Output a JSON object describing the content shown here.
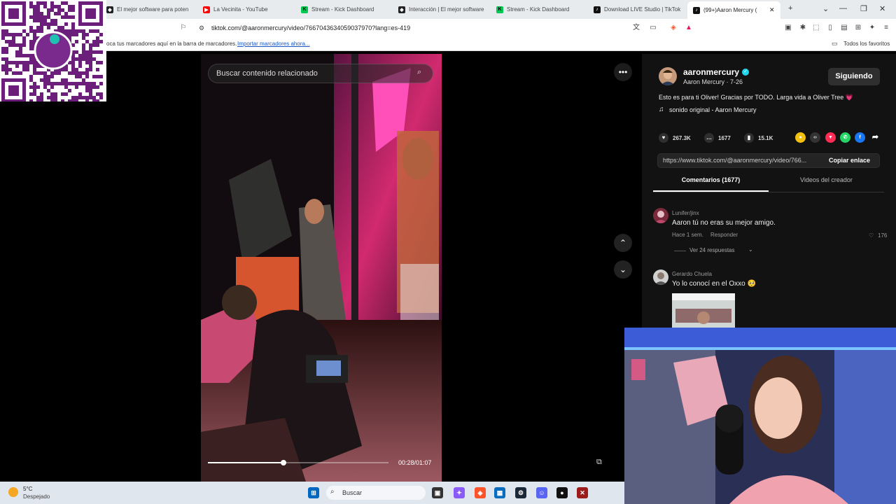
{
  "browser": {
    "tabs": [
      {
        "label": "El mejor software para poten",
        "favicon": "tiktok-studio-icon",
        "color": "#222"
      },
      {
        "label": "La Vecinita - YouTube",
        "favicon": "youtube-icon",
        "color": "#ff0000"
      },
      {
        "label": "Stream - Kick Dashboard",
        "favicon": "kick-icon",
        "color": "#00c853"
      },
      {
        "label": "Interacción | El mejor software",
        "favicon": "tiktok-studio-icon",
        "color": "#222"
      },
      {
        "label": "Stream - Kick Dashboard",
        "favicon": "kick-icon",
        "color": "#00c853"
      },
      {
        "label": "Download LIVE Studio | TikTok",
        "favicon": "tiktok-icon",
        "color": "#111"
      },
      {
        "label": "(99+)Aaron Mercury (",
        "favicon": "tiktok-icon",
        "color": "#111"
      }
    ],
    "url": "tiktok.com/@aaronmercury/video/7667043634059037970?lang=es-419",
    "bookmarks_hint": "oca tus marcadores aquí en la barra de marcadores.",
    "bookmarks_import": "Importar marcadores ahora...",
    "all_favorites": "Todos los favoritos"
  },
  "video": {
    "search_placeholder": "Buscar contenido relacionado",
    "time": "00:28/01:07",
    "progress": 0.42
  },
  "creator": {
    "username": "aaronmercury",
    "display": "Aaron Mercury · 7-26",
    "follow_label": "Siguiendo",
    "description": "Esto es para ti Oliver! Gracias por TODO. Larga vida a Oliver Tree 💗",
    "sound": "sonido original - Aaron Mercury"
  },
  "stats": {
    "likes": "267.3K",
    "comments": "1677",
    "saves": "15.1K"
  },
  "link": {
    "url": "https://www.tiktok.com/@aaronmercury/video/766...",
    "copy_label": "Copiar enlace"
  },
  "tabs": {
    "comments": "Comentarios (1677)",
    "videos": "Videos del creador"
  },
  "comments": [
    {
      "user": "Lunifer/jinx",
      "text": "Aaron tú no eras su mejor amigo.",
      "time": "Hace 1 sem.",
      "reply": "Responder",
      "likes": "176",
      "replies": "Ver 24 respuestas"
    },
    {
      "user": "Gerardo Chuela",
      "text": "Yo lo conocí en el Oxxo 🥺"
    }
  ],
  "taskbar": {
    "weather_temp": "5°C",
    "weather_desc": "Despejado",
    "search": "Buscar"
  }
}
